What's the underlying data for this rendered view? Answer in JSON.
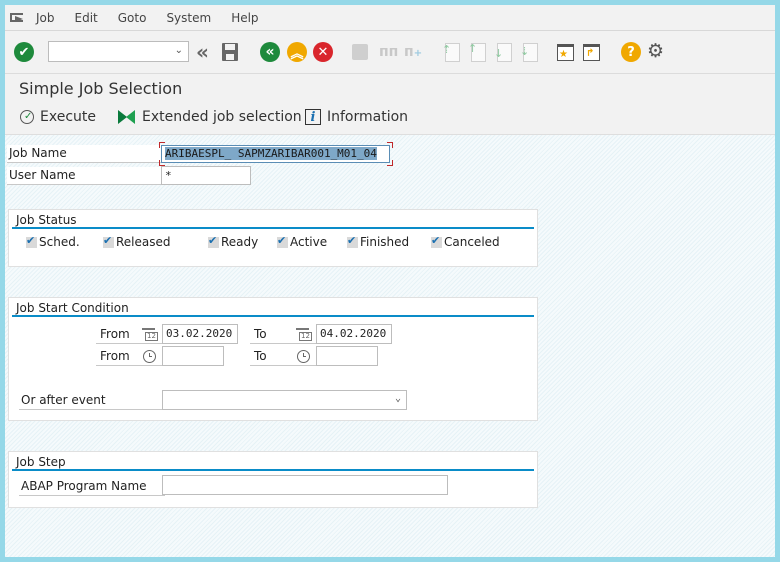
{
  "menubar": {
    "items": [
      "Job",
      "Edit",
      "Goto",
      "System",
      "Help"
    ]
  },
  "toolbar": {
    "command_field_value": "",
    "icons": [
      "enter-icon",
      "back-double-icon",
      "save-icon",
      "back-icon",
      "exit-icon",
      "cancel-icon",
      "print-icon",
      "find-icon",
      "find-next-icon",
      "first-page-icon",
      "previous-page-icon",
      "next-page-icon",
      "last-page-icon",
      "create-session-icon",
      "shortcut-icon",
      "help-icon",
      "settings-icon"
    ]
  },
  "title": "Simple Job Selection",
  "appbar": {
    "execute": "Execute",
    "extended": "Extended job selection",
    "information": "Information"
  },
  "fields": {
    "job_name_label": "Job Name",
    "job_name_value": "ARIBAESPL_ SAPMZARIBAR001_M01_04",
    "user_name_label": "User Name",
    "user_name_value": "*"
  },
  "job_status": {
    "title": "Job Status",
    "options": [
      {
        "label": "Sched.",
        "checked": true
      },
      {
        "label": "Released",
        "checked": true
      },
      {
        "label": "Ready",
        "checked": true
      },
      {
        "label": "Active",
        "checked": true
      },
      {
        "label": "Finished",
        "checked": true
      },
      {
        "label": "Canceled",
        "checked": true
      }
    ]
  },
  "start_condition": {
    "title": "Job Start Condition",
    "from_label": "From",
    "to_label": "To",
    "date_from": "03.02.2020",
    "date_to": "04.02.2020",
    "time_from": "",
    "time_to": "",
    "event_label": "Or after event",
    "event_value": ""
  },
  "job_step": {
    "title": "Job Step",
    "program_label": "ABAP Program Name",
    "program_value": ""
  }
}
